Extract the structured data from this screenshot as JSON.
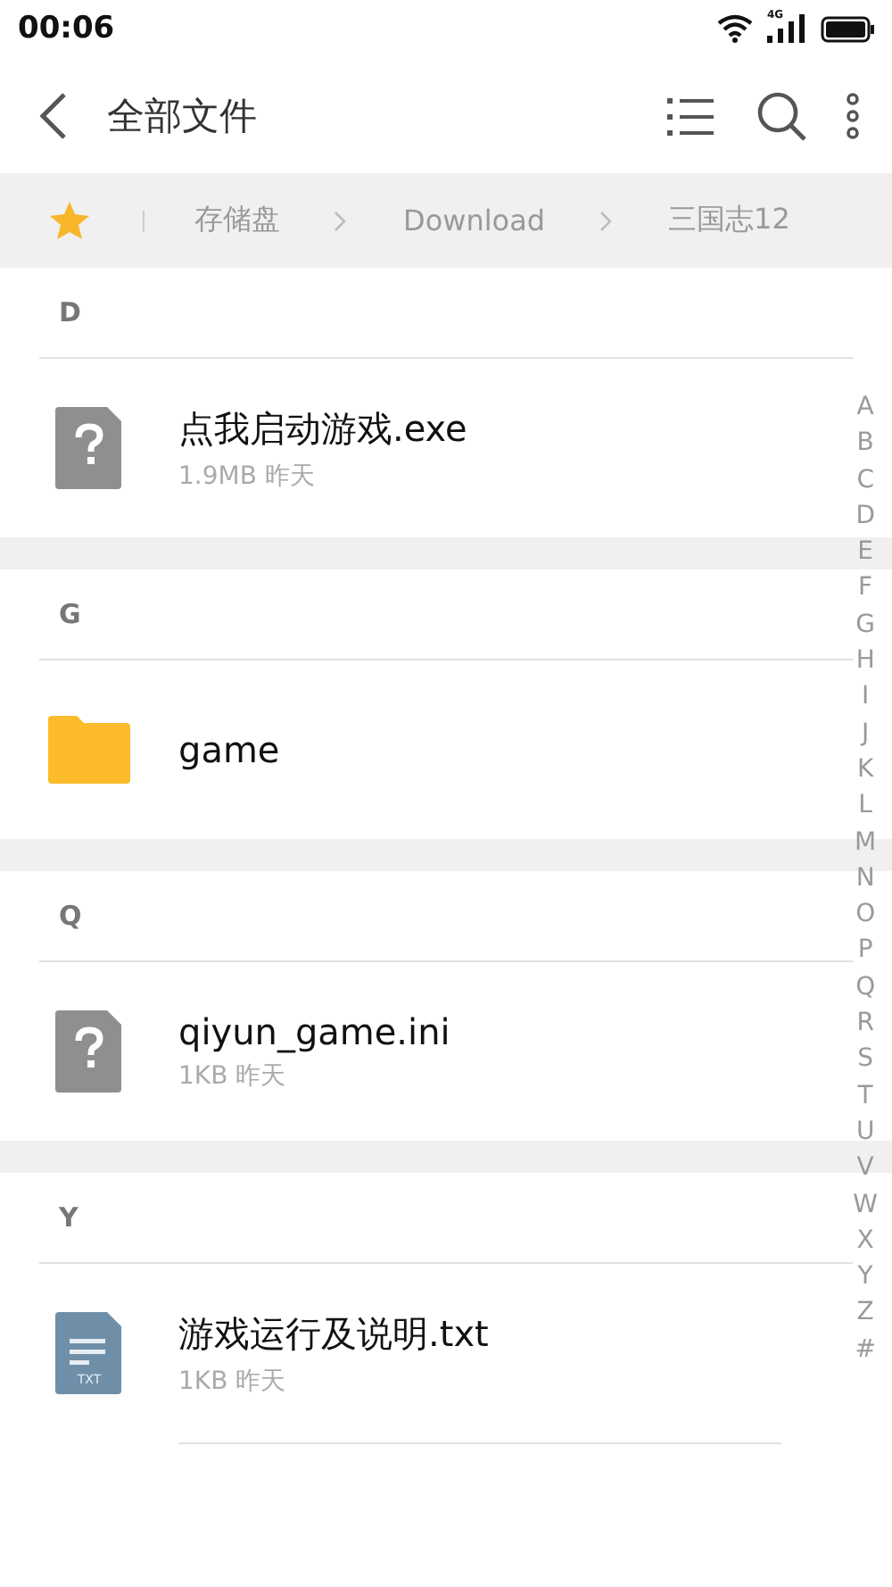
{
  "status_bar": {
    "time": "00:06",
    "network": "4G"
  },
  "toolbar": {
    "title": "全部文件"
  },
  "breadcrumb": [
    "存储盘",
    "Download",
    "三国志12"
  ],
  "sections": [
    {
      "letter": "D",
      "files": [
        {
          "kind": "unknown",
          "name": "点我启动游戏.exe",
          "meta": "1.9MB  昨天"
        }
      ]
    },
    {
      "letter": "G",
      "files": [
        {
          "kind": "folder",
          "name": "game"
        }
      ]
    },
    {
      "letter": "Q",
      "files": [
        {
          "kind": "unknown",
          "name": "qiyun_game.ini",
          "meta": "1KB  昨天"
        }
      ]
    },
    {
      "letter": "Y",
      "files": [
        {
          "kind": "text",
          "name": "游戏运行及说明.txt",
          "meta": "1KB  昨天",
          "icon_label": "TXT"
        }
      ]
    }
  ],
  "index_letters": [
    "A",
    "B",
    "C",
    "D",
    "E",
    "F",
    "G",
    "H",
    "I",
    "J",
    "K",
    "L",
    "M",
    "N",
    "O",
    "P",
    "Q",
    "R",
    "S",
    "T",
    "U",
    "V",
    "W",
    "X",
    "Y",
    "Z",
    "#"
  ]
}
